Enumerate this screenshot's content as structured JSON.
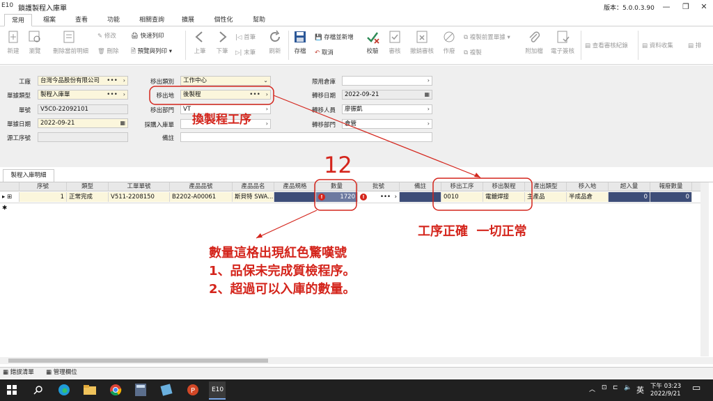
{
  "window": {
    "app_code": "E10",
    "title": "鎖護製程入庫單",
    "version": "版本：5.0.0.3.90"
  },
  "tabs": [
    "常用",
    "檔案",
    "查看",
    "功能",
    "相關查詢",
    "擴展",
    "個性化",
    "幫助"
  ],
  "ribbon": {
    "new": "新建",
    "browse": "瀏覽",
    "delete_detail": "刪除當前明細",
    "modify": "修改",
    "remove": "刪除",
    "quick_print": "快速列印",
    "preview_print": "預覽與列印",
    "prev": "上筆",
    "next": "下筆",
    "first": "首筆",
    "last": "末筆",
    "refresh": "刷新",
    "save": "存檔",
    "save_new": "存檔並新增",
    "cancel": "取消",
    "validate": "校驗",
    "approve": "審核",
    "unapprove": "撤銷審核",
    "void": "作廢",
    "copy_prev": "複製前置單據",
    "copy": "複製",
    "attach": "附加檔",
    "esign": "電子簽核",
    "view_audit": "查看審核紀錄",
    "data_collect": "資料收集",
    "more": "排"
  },
  "form": {
    "factory_label": "工廠",
    "factory": "台灣今品股份有限公司",
    "doc_type_label": "單據類型",
    "doc_type": "製程入庫單",
    "doc_no_label": "單號",
    "doc_no": "V5C0-22092101",
    "doc_date_label": "單據日期",
    "doc_date": "2022-09-21",
    "source_label": "源工序號",
    "source": "",
    "out_type_label": "移出類別",
    "out_type": "工作中心",
    "out_place_label": "移出地",
    "out_place": "後製程",
    "out_dept_label": "移出部門",
    "out_dept": "VT",
    "purchase_label": "採購入庫單",
    "purchase": "",
    "remark_label": "備註",
    "remark": "",
    "limit_wh_label": "限用倉庫",
    "limit_wh": "",
    "transfer_date_label": "轉移日期",
    "transfer_date": "2022-09-21",
    "transfer_person_label": "轉移人員",
    "transfer_person": "廖振凱",
    "transfer_dept_label": "轉移部門",
    "transfer_dept": "倉管"
  },
  "detail_tab": "製程入庫明細",
  "grid": {
    "headers": [
      "序號",
      "類型",
      "工單單號",
      "產品品號",
      "產品品名",
      "產品規格",
      "數量",
      "批號",
      "備註",
      "移出工序",
      "移出製程",
      "產出類型",
      "移入地",
      "超入量",
      "報廢數量"
    ],
    "row": {
      "seq": "1",
      "type": "正常完成",
      "wo": "V511-2208150",
      "item": "B2202-A00061",
      "name": "斯貝特 SWA...",
      "spec": "",
      "qty": "1720",
      "lot": "",
      "remark": "",
      "op": "0010",
      "process": "電鍍焊接",
      "out_type": "主產品",
      "to": "半成品倉",
      "over": "0",
      "scrap": "0"
    }
  },
  "bottom_tabs": [
    "錯誤清單",
    "管理欄位"
  ],
  "taskbar": {
    "app": "E10",
    "lang": "英",
    "time": "下午 03:23",
    "date": "2022/9/21"
  },
  "annotations": {
    "process_change": "換製程工序",
    "number": "12",
    "correct": "工序正確  一切正常",
    "warn_line1": "數量這格出現紅色驚嘆號",
    "warn_line2": "1、品保未完成質檢程序。",
    "warn_line3": "2、超過可以入庫的數量。"
  },
  "colors": {
    "annotation": "#d4251c",
    "selected_cell": "#3d4d78",
    "required_field": "#fbf6dc"
  }
}
